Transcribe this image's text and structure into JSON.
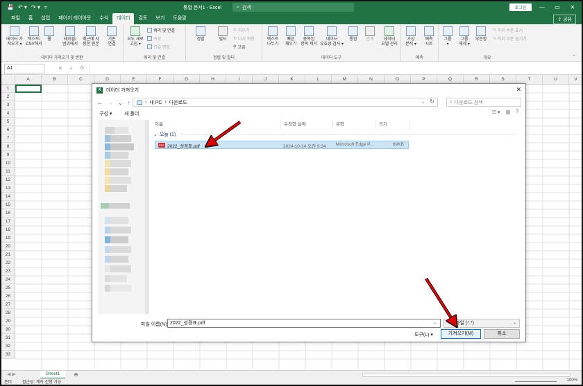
{
  "titlebar": {
    "title": "통합 문서1 - Excel",
    "search_placeholder": "검색",
    "login_label": "로그인",
    "qat_save": "💾",
    "qat_undo": "↶ ▾",
    "qat_redo": "↷ ▾",
    "qat_more": "▿",
    "min": "—",
    "restore": "▭",
    "close": "✕",
    "opts": "⧉"
  },
  "menu": {
    "tabs": [
      "파일",
      "홈",
      "삽입",
      "페이지 레이아웃",
      "수식",
      "데이터",
      "검토",
      "보기",
      "도움말"
    ],
    "active_index": 5,
    "share_label": "공유"
  },
  "ribbon": {
    "groups": [
      {
        "label": "데이터 가져오기 및 변환",
        "buttons": [
          "데이터 가\n져오기 ▾",
          "텍스트/\nCSV에서",
          "웹",
          "테이블/\n범위에서",
          "최근에 사\n용한 원본",
          "기존\n연결"
        ]
      },
      {
        "label": "쿼리 및 연결",
        "buttons": [
          "모두 새로\n고침 ▾"
        ],
        "small": [
          "쿼리 및 연결",
          "속성",
          "연결 편집"
        ]
      },
      {
        "label": "정렬 및 필터",
        "buttons": [
          "정렬",
          "필터"
        ],
        "small": [
          "지우기",
          "다시 적용",
          "고급"
        ]
      },
      {
        "label": "데이터 도구",
        "buttons": [
          "텍스트\n나누기",
          "빠른\n채우기",
          "중복된\n항목 제거",
          "데이터\n유효성 검사 ▾",
          "통합",
          "관계",
          "데이터\n모델 관리"
        ]
      },
      {
        "label": "예측",
        "buttons": [
          "가상\n분석 ▾",
          "예측\n시트"
        ]
      },
      {
        "label": "개요",
        "buttons": [
          "그룹\n▾",
          "그룹\n해제 ▾",
          "부분합"
        ],
        "small": [
          "하위 수준 표시",
          "하위 수준 숨기기"
        ]
      }
    ]
  },
  "formula": {
    "namebox": "A1",
    "cancel": "✕",
    "enter": "✓",
    "fx": "fx"
  },
  "sheet": {
    "columns": [
      "A",
      "B",
      "C",
      "D",
      "E",
      "F",
      "G",
      "H",
      "I",
      "J",
      "K",
      "L",
      "M",
      "N",
      "O",
      "P",
      "Q",
      "R",
      "S",
      "T",
      "U",
      "V"
    ],
    "rows": [
      "1",
      "2",
      "3",
      "4",
      "5",
      "6",
      "7",
      "8",
      "9",
      "10",
      "11",
      "12",
      "13",
      "14",
      "15",
      "16",
      "17",
      "18",
      "19",
      "20",
      "21",
      "22",
      "23",
      "24",
      "25",
      "26",
      "27",
      "28",
      "29",
      "30",
      "31",
      "32",
      "33"
    ],
    "tab": "Sheet1",
    "add": "⊕",
    "nav": "◀ ▶"
  },
  "status": {
    "ready": "준비",
    "accessibility": "접근성: 계속 진행 가능",
    "zoom": "100%"
  },
  "dialog": {
    "title": "데이터 가져오기",
    "close": "✕",
    "back": "←",
    "forward": "→",
    "recent": "⌄",
    "up": "↑",
    "address": [
      "내 PC",
      "다운로드"
    ],
    "sep": "›",
    "search_placeholder": "다운로드 검색",
    "organize": "구성 ▾",
    "new_folder": "새 폴더",
    "view_icons": [
      "☷ ▾",
      "▥",
      "?"
    ],
    "columns": [
      "이름",
      "수정한 날짜",
      "유형",
      "크기"
    ],
    "group": "오늘 (1)",
    "file": {
      "name": "2022_성경표.pdf",
      "modified": "2024-10-14 오전 9:34",
      "type": "Microsoft Edge P...",
      "size": "69KB"
    },
    "filename_label": "파일 이름(N):",
    "filename_value": "2022_성경표.pdf",
    "filetype": "파일 (*.*)",
    "tools": "도구(L) ▾",
    "open": "가져오기(M)",
    "cancel": "취소"
  },
  "colors": {
    "excel_green": "#217346",
    "highlight": "#cce4f7",
    "arrow": "#e00000"
  }
}
